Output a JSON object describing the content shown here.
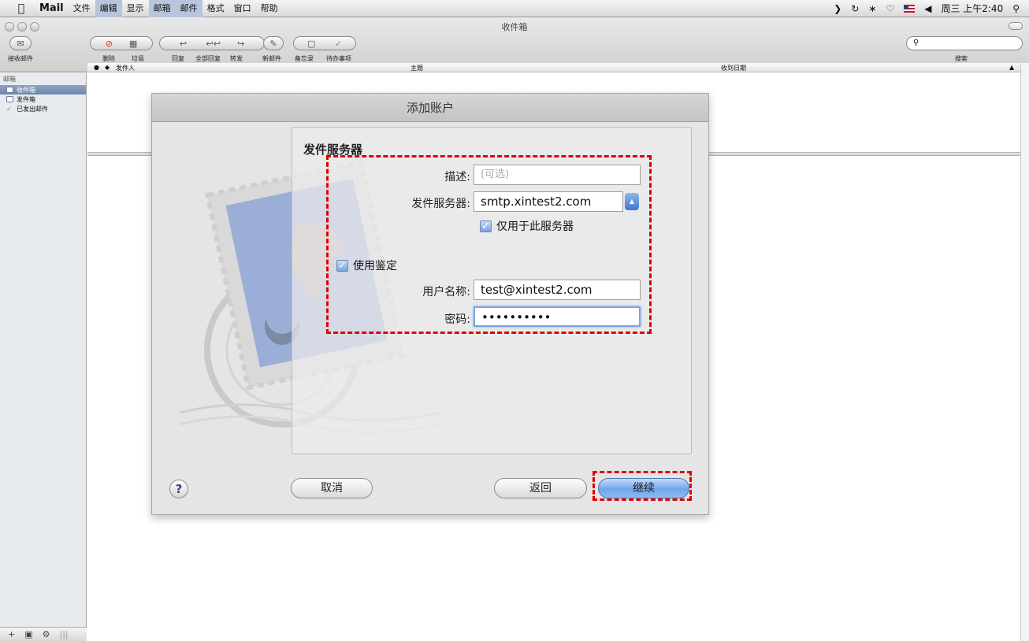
{
  "menubar": {
    "app_name": "Mail",
    "items": [
      "文件",
      "编辑",
      "显示",
      "邮箱",
      "邮件",
      "格式",
      "窗口",
      "帮助"
    ],
    "clock": "周三 上午2:40"
  },
  "window": {
    "title": "收件箱",
    "toolbar": {
      "get_mail": "接收邮件",
      "delete": "删除",
      "junk": "垃圾",
      "reply": "回复",
      "reply_all": "全部回复",
      "forward": "转发",
      "new_message": "新邮件",
      "note": "备忘录",
      "todo": "待办事项",
      "search_label": "搜索"
    }
  },
  "sidebar": {
    "header": "邮箱",
    "items": [
      {
        "label": "收件箱",
        "selected": true
      },
      {
        "label": "发件箱",
        "selected": false
      },
      {
        "label": "已发出邮件",
        "selected": false
      }
    ]
  },
  "message_list": {
    "columns": {
      "from": "发件人",
      "subject": "主题",
      "date": "收到日期"
    }
  },
  "dialog": {
    "title": "添加账户",
    "section_title": "发件服务器",
    "description_label": "描述:",
    "description_placeholder": "(可选)",
    "server_label": "发件服务器:",
    "server_value": "smtp.xintest2.com",
    "only_this_server_label": "仅用于此服务器",
    "use_auth_label": "使用鉴定",
    "username_label": "用户名称:",
    "username_value": "test@xintest2.com",
    "password_label": "密码:",
    "password_value": "••••••••••",
    "cancel_button": "取消",
    "back_button": "返回",
    "continue_button": "继续",
    "only_this_server_checked": true,
    "use_auth_checked": true
  },
  "colors": {
    "highlight_dash": "#e00000",
    "default_button": "#6fa5ec"
  }
}
